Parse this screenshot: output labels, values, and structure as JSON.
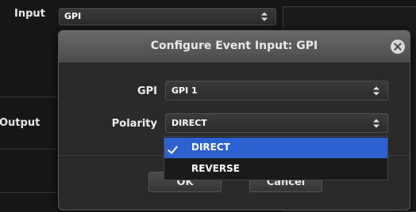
{
  "background": {
    "input_label": "Input",
    "input_value": "GPI",
    "output_label": "Output"
  },
  "modal": {
    "title": "Configure Event Input: GPI",
    "gpi_label": "GPI",
    "gpi_value": "GPI 1",
    "polarity_label": "Polarity",
    "polarity_value": "DIRECT",
    "ok_label": "OK",
    "cancel_label": "Cancel"
  },
  "dropdown": {
    "options": [
      "DIRECT",
      "REVERSE"
    ],
    "selected": "DIRECT"
  },
  "colors": {
    "accent": "#2d61d2",
    "modal_header": "#5a5a5a",
    "background": "#161616"
  }
}
